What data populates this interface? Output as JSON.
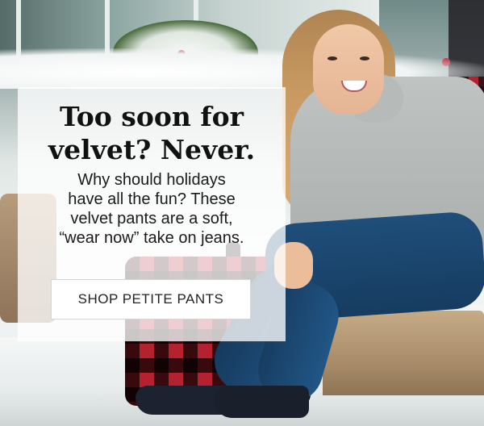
{
  "hero": {
    "headline_lines": [
      "Too soon for",
      "velvet? Never."
    ],
    "body_lines": [
      "Why should holidays",
      "have all the fun? These",
      "velvet pants are a soft,",
      "“wear now” take on jeans."
    ],
    "cta_label": "SHOP PETITE PANTS"
  },
  "colors": {
    "headline": "#111111",
    "overlay": "rgba(255,255,255,0.78)",
    "button_bg": "#ffffff",
    "jeans": "#1f4e7a",
    "check_red": "#b5222f"
  }
}
